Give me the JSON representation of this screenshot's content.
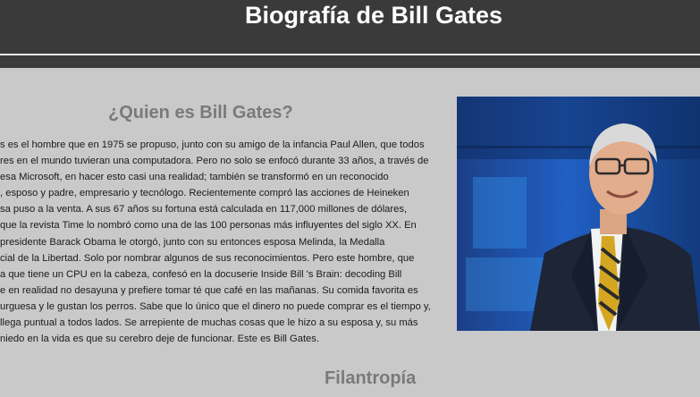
{
  "header": {
    "title": "Biografía de Bill Gates"
  },
  "section1": {
    "heading": "¿Quien es Bill Gates?",
    "lines": [
      "s es el hombre que en 1975 se propuso, junto con su amigo de la infancia Paul Allen, que todos",
      "res en el mundo tuvieran una computadora. Pero no solo se enfocó durante 33 años, a través de",
      "esa Microsoft, en hacer esto casi una realidad; también se transformó en un reconocido",
      ", esposo y padre, empresario y tecnólogo. Recientemente compró las acciones de Heineken",
      "sa puso a la venta. A sus 67 años su fortuna está calculada en 117,000 millones de dólares,",
      "que la revista Time lo nombró como una de las 100 personas más influyentes del siglo XX. En",
      "presidente Barack Obama le otorgó, junto con su entonces esposa Melinda, la Medalla",
      "cial de la Libertad. Solo por nombrar algunos de sus reconocimientos. Pero este hombre, que",
      "a que tiene un CPU en la cabeza, confesó en la docuserie Inside Bill 's Brain: decoding Bill",
      "e en realidad no desayuna y prefiere tomar té que café en las mañanas. Su comida favorita es",
      "urguesa y le gustan los perros. Sabe que lo único que el dinero no puede comprar es el tiempo y,",
      "llega puntual a todos lados. Se arrepiente de muchas cosas que le hizo a su esposa y, su más",
      "niedo en la vida es que su cerebro deje de funcionar. Este es Bill Gates."
    ]
  },
  "section2": {
    "heading": "Filantropía"
  }
}
